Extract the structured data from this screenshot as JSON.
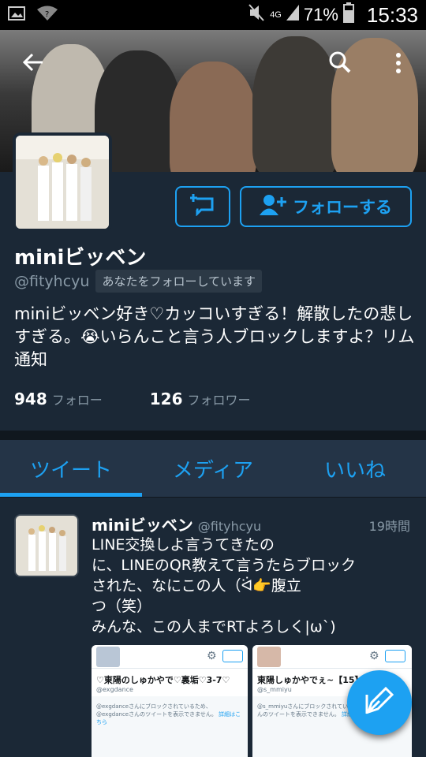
{
  "status_bar": {
    "battery": "71%",
    "network": "4G",
    "time": "15:33"
  },
  "profile": {
    "display_name": "miniビッベン",
    "handle": "@fityhcyu",
    "follows_you": "あなたをフォローしています",
    "bio": "miniビッベン好き♡カッコいすぎる！解散したの悲しすぎる。😭いらんこと言う人ブロックしますよ？リム通知",
    "following_count": "948",
    "following_label": "フォロー",
    "followers_count": "126",
    "followers_label": "フォロワー",
    "follow_button": "フォローする"
  },
  "tabs": [
    {
      "label": "ツイート",
      "active": true
    },
    {
      "label": "メディア",
      "active": false
    },
    {
      "label": "いいね",
      "active": false
    }
  ],
  "tweet": {
    "name": "miniビッベン",
    "handle": "@fityhcyu",
    "time": "19時間",
    "text": "LINE交換しよ言うてきたの\nに、LINEのQR教えて言うたらブロック\nされた、なにこの人（ᐛ👉腹立\nつ（笑）\nみんな、この人までRTよろしく|ω`)",
    "media": [
      {
        "title": "♡東陽のしゅかやで♡裏垢♡3-7♡",
        "handle": "@exgdance",
        "message": "@exgdanceさんにブロックされているため、@exgdanceさんのツイートを表示できません。",
        "link": "詳細はこちら"
      },
      {
        "title": "東陽しゅかやでぇ~【15】",
        "handle": "@s_mmiyu",
        "message": "@s_mmiyuさんにブロックされているため、@s_mmiyuさんのツイートを表示できません。",
        "link": "詳細はこちら"
      }
    ]
  },
  "colors": {
    "accent": "#1da1f2",
    "background": "#1b2836",
    "secondary_text": "#8899a6"
  },
  "icons": {
    "back": "back-arrow-icon",
    "search": "search-icon",
    "more": "overflow-menu-icon",
    "dm": "direct-message-icon",
    "follow": "add-user-icon",
    "compose": "compose-tweet-icon"
  }
}
